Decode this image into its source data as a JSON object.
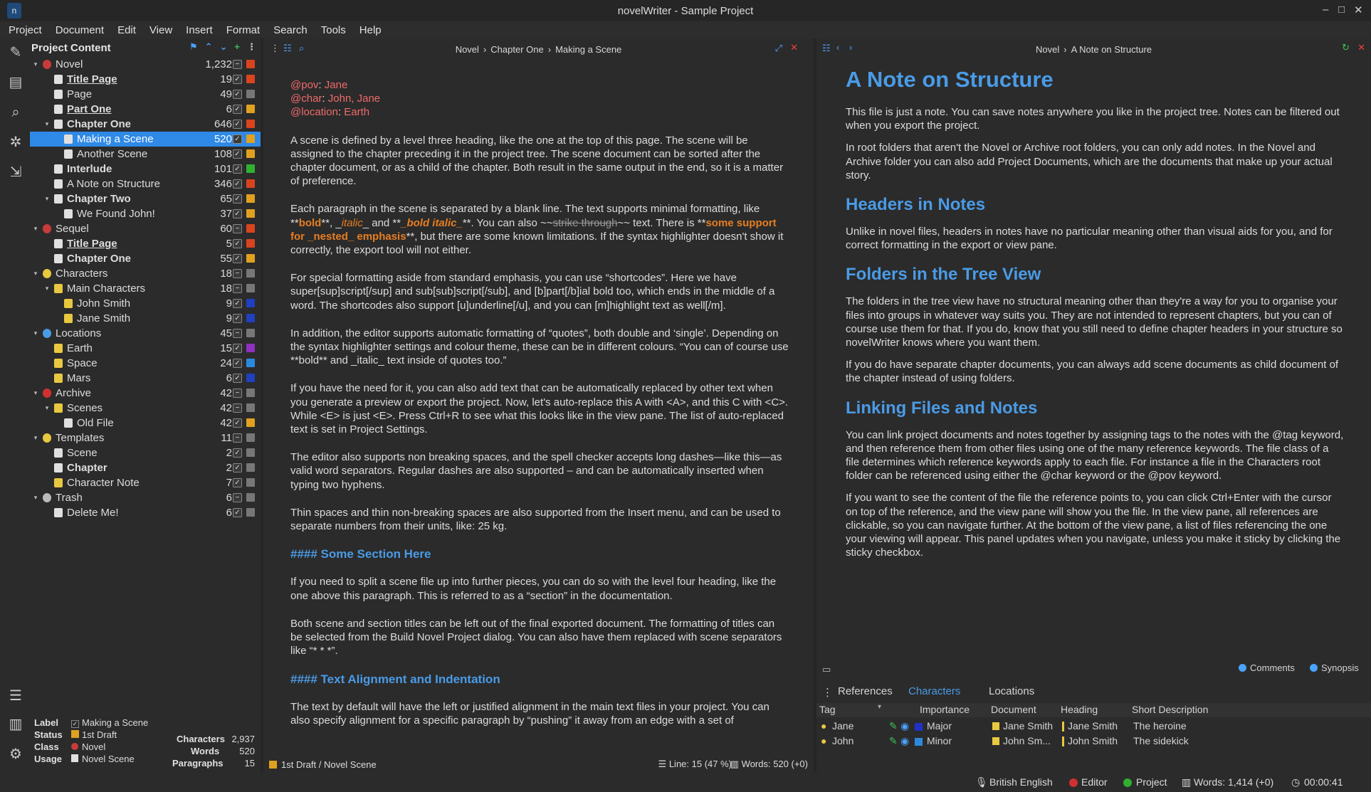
{
  "window": {
    "title": "novelWriter - Sample Project",
    "icon": "app-icon"
  },
  "menu": [
    "Project",
    "Document",
    "Edit",
    "View",
    "Insert",
    "Format",
    "Search",
    "Tools",
    "Help"
  ],
  "sidebar_icons": [
    "edit-icon",
    "book-icon",
    "search-icon",
    "plugin-icon",
    "export-icon",
    "outline-icon",
    "stats-icon",
    "settings-icon"
  ],
  "tree": {
    "title": "Project Content",
    "rows": [
      {
        "label": "Novel",
        "count": "1,232",
        "level": 0,
        "arrow": "▾",
        "icon": "#c83b3b",
        "chk": "−",
        "color": "#d9441f",
        "bold": false,
        "ul": false
      },
      {
        "label": "Title Page",
        "count": "19",
        "level": 1,
        "arrow": "",
        "icon": "#e0e0e0",
        "chk": "✓",
        "color": "#d9441f",
        "bold": true,
        "ul": true
      },
      {
        "label": "Page",
        "count": "49",
        "level": 1,
        "arrow": "",
        "icon": "#e0e0e0",
        "chk": "✓",
        "color": "#777777",
        "bold": false,
        "ul": false
      },
      {
        "label": "Part One",
        "count": "6",
        "level": 1,
        "arrow": "",
        "icon": "#e0e0e0",
        "chk": "✓",
        "color": "#e0a020",
        "bold": true,
        "ul": true
      },
      {
        "label": "Chapter One",
        "count": "646",
        "level": 1,
        "arrow": "▾",
        "icon": "#e0e0e0",
        "chk": "✓",
        "color": "#d9441f",
        "bold": true,
        "ul": false
      },
      {
        "label": "Making a Scene",
        "count": "520",
        "level": 2,
        "arrow": "",
        "icon": "#e0e0e0",
        "chk": "✓",
        "color": "#e0a020",
        "bold": false,
        "ul": false,
        "sel": true
      },
      {
        "label": "Another Scene",
        "count": "108",
        "level": 2,
        "arrow": "",
        "icon": "#e0e0e0",
        "chk": "✓",
        "color": "#e0a020",
        "bold": false,
        "ul": false
      },
      {
        "label": "Interlude",
        "count": "101",
        "level": 1,
        "arrow": "",
        "icon": "#e0e0e0",
        "chk": "✓",
        "color": "#30b030",
        "bold": true,
        "ul": false
      },
      {
        "label": "A Note on Structure",
        "count": "346",
        "level": 1,
        "arrow": "",
        "icon": "#e0e0e0",
        "chk": "✓",
        "color": "#d9441f",
        "bold": false,
        "ul": false
      },
      {
        "label": "Chapter Two",
        "count": "65",
        "level": 1,
        "arrow": "▾",
        "icon": "#e0e0e0",
        "chk": "✓",
        "color": "#e0a020",
        "bold": true,
        "ul": false
      },
      {
        "label": "We Found John!",
        "count": "37",
        "level": 2,
        "arrow": "",
        "icon": "#e0e0e0",
        "chk": "✓",
        "color": "#e0a020",
        "bold": false,
        "ul": false
      },
      {
        "label": "Sequel",
        "count": "60",
        "level": 0,
        "arrow": "▾",
        "icon": "#c83b3b",
        "chk": "−",
        "color": "#d9441f",
        "bold": false,
        "ul": false
      },
      {
        "label": "Title Page",
        "count": "5",
        "level": 1,
        "arrow": "",
        "icon": "#e0e0e0",
        "chk": "✓",
        "color": "#d9441f",
        "bold": true,
        "ul": true
      },
      {
        "label": "Chapter One",
        "count": "55",
        "level": 1,
        "arrow": "",
        "icon": "#e0e0e0",
        "chk": "✓",
        "color": "#e0a020",
        "bold": true,
        "ul": false
      },
      {
        "label": "Characters",
        "count": "18",
        "level": 0,
        "arrow": "▾",
        "icon": "#e8c840",
        "chk": "−",
        "color": "#777777",
        "bold": false,
        "ul": false
      },
      {
        "label": "Main Characters",
        "count": "18",
        "level": 1,
        "arrow": "▾",
        "icon": "#e8c840",
        "chk": "−",
        "color": "#777777",
        "bold": false,
        "ul": false
      },
      {
        "label": "John Smith",
        "count": "9",
        "level": 2,
        "arrow": "",
        "icon": "#e8c840",
        "chk": "✓",
        "color": "#2040c0",
        "bold": false,
        "ul": false
      },
      {
        "label": "Jane Smith",
        "count": "9",
        "level": 2,
        "arrow": "",
        "icon": "#e8c840",
        "chk": "✓",
        "color": "#2040c0",
        "bold": false,
        "ul": false
      },
      {
        "label": "Locations",
        "count": "45",
        "level": 0,
        "arrow": "▾",
        "icon": "#4a9be6",
        "chk": "−",
        "color": "#777777",
        "bold": false,
        "ul": false
      },
      {
        "label": "Earth",
        "count": "15",
        "level": 1,
        "arrow": "",
        "icon": "#e8c840",
        "chk": "✓",
        "color": "#9030c0",
        "bold": false,
        "ul": false
      },
      {
        "label": "Space",
        "count": "24",
        "level": 1,
        "arrow": "",
        "icon": "#e8c840",
        "chk": "✓",
        "color": "#2a8ae0",
        "bold": false,
        "ul": false
      },
      {
        "label": "Mars",
        "count": "6",
        "level": 1,
        "arrow": "",
        "icon": "#e8c840",
        "chk": "✓",
        "color": "#2040c0",
        "bold": false,
        "ul": false
      },
      {
        "label": "Archive",
        "count": "42",
        "level": 0,
        "arrow": "▾",
        "icon": "#d03030",
        "chk": "−",
        "color": "#777777",
        "bold": false,
        "ul": false
      },
      {
        "label": "Scenes",
        "count": "42",
        "level": 1,
        "arrow": "▾",
        "icon": "#e8c840",
        "chk": "−",
        "color": "#777777",
        "bold": false,
        "ul": false
      },
      {
        "label": "Old File",
        "count": "42",
        "level": 2,
        "arrow": "",
        "icon": "#e0e0e0",
        "chk": "✓",
        "color": "#e0a020",
        "bold": false,
        "ul": false
      },
      {
        "label": "Templates",
        "count": "11",
        "level": 0,
        "arrow": "▾",
        "icon": "#e8c840",
        "chk": "−",
        "color": "#777777",
        "bold": false,
        "ul": false
      },
      {
        "label": "Scene",
        "count": "2",
        "level": 1,
        "arrow": "",
        "icon": "#e0e0e0",
        "chk": "✓",
        "color": "#777777",
        "bold": false,
        "ul": false
      },
      {
        "label": "Chapter",
        "count": "2",
        "level": 1,
        "arrow": "",
        "icon": "#e0e0e0",
        "chk": "✓",
        "color": "#777777",
        "bold": true,
        "ul": false
      },
      {
        "label": "Character Note",
        "count": "7",
        "level": 1,
        "arrow": "",
        "icon": "#e8c840",
        "chk": "✓",
        "color": "#777777",
        "bold": false,
        "ul": false
      },
      {
        "label": "Trash",
        "count": "6",
        "level": 0,
        "arrow": "▾",
        "icon": "#bbbbbb",
        "chk": "−",
        "color": "#777777",
        "bold": false,
        "ul": false
      },
      {
        "label": "Delete Me!",
        "count": "6",
        "level": 1,
        "arrow": "",
        "icon": "#e0e0e0",
        "chk": "✓",
        "color": "#777777",
        "bold": false,
        "ul": false
      }
    ]
  },
  "details": {
    "label_key": "Label",
    "label_val": "Making a Scene",
    "status_key": "Status",
    "status_val": "1st Draft",
    "class_key": "Class",
    "class_val": "Novel",
    "usage_key": "Usage",
    "usage_val": "Novel Scene",
    "chars_key": "Characters",
    "chars_val": "2,937",
    "words_key": "Words",
    "words_val": "520",
    "paras_key": "Paragraphs",
    "paras_val": "15"
  },
  "editor": {
    "crumb": [
      "Novel",
      "Chapter One",
      "Making a Scene"
    ],
    "meta": [
      {
        "k": "@pov",
        "v": "Jane"
      },
      {
        "k": "@char",
        "v": "John, Jane"
      },
      {
        "k": "@location",
        "v": "Earth"
      }
    ],
    "p1": "A scene is defined by a level three heading, like the one at the top of this page. The scene will be assigned to the chapter preceding it in the project tree. The scene document can be sorted after the chapter document, or as a child of the chapter. Both result in the same output in the end, so it is a matter of preference.",
    "p2a": "Each paragraph in the scene is separated by a blank line. The text supports minimal formatting, like **",
    "p2b": "bold",
    "p2c": "**, _",
    "p2d": "italic",
    "p2e": "_ and **",
    "p2f": "_bold italic_",
    "p2g": "**. You can also ~~",
    "p2h": "strike through",
    "p2i": "~~ text. There is **",
    "p2j": "some support for _nested_ emphasis",
    "p2k": "**, but there are some known limitations. If the syntax highlighter doesn't show it correctly, the export tool will not either.",
    "p3": "For special formatting aside from standard emphasis, you can use “shortcodes”. Here we have super[sup]script[/sup] and sub[sub]script[/sub], and [b]part[/b]ial bold too, which ends in the middle of a word. The shortcodes also support [u]underline[/u], and you can [m]highlight text as well[/m].",
    "p4": "In addition, the editor supports automatic formatting of “quotes”, both double and ‘single’. Depending on the syntax highlighter settings and colour theme, these can be in different colours. “You can of course use **bold** and _italic_ text inside of quotes too.”",
    "p5": "If you have the need for it, you can also add text that can be automatically replaced by other text when you generate a preview or export the project. Now, let's auto-replace this A with <A>, and this C with <C>. While <E> is just <E>. Press Ctrl+R to see what this looks like in the view pane. The list of auto-replaced text is set in Project Settings.",
    "p6": "The editor also supports non breaking spaces, and the spell checker accepts long dashes—like this—as valid word separators. Regular dashes are also supported – and can be automatically inserted when typing two hyphens.",
    "p7": "Thin spaces and thin non-breaking spaces are also supported from the Insert menu, and can be used to separate numbers from their units, like: 25 kg.",
    "h4a": "#### Some Section Here",
    "p8": "If you need to split a scene file up into further pieces, you can do so with the level four heading, like the one above this paragraph. This is referred to as a “section” in the documentation.",
    "p9": "Both scene and section titles can be left out of the final exported document. The formatting of titles can be selected from the Build Novel Project dialog. You can also have them replaced with scene separators like “* * *”.",
    "h4b": "#### Text Alignment and Indentation",
    "p10": "The text by default will have the left or justified alignment in the main text files in your project. You can also specify alignment for a specific paragraph by “pushing” it away from an edge with a set of",
    "foot_status": "1st Draft / Novel Scene",
    "foot_line": "Line: 15 (47 %)",
    "foot_words": "Words: 520 (+0)"
  },
  "viewer": {
    "crumb": [
      "Novel",
      "A Note on Structure"
    ],
    "h1": "A Note on Structure",
    "p1": "This file is just a note. You can save notes anywhere you like in the project tree. Notes can be filtered out when you export the project.",
    "p2": "In root folders that aren't the Novel or Archive root folders, you can only add notes. In the Novel and Archive folder you can also add Project Documents, which are the documents that make up your actual story.",
    "h2a": "Headers in Notes",
    "p3": "Unlike in novel files, headers in notes have no particular meaning other than visual aids for you, and for correct formatting in the export or view pane.",
    "h2b": "Folders in the Tree View",
    "p4": "The folders in the tree view have no structural meaning other than they're a way for you to organise your files into groups in whatever way suits you. They are not intended to represent chapters, but you can of course use them for that. If you do, know that you still need to define chapter headers in your structure so novelWriter knows where you want them.",
    "p5": "If you do have separate chapter documents, you can always add scene documents as child document of the chapter instead of using folders.",
    "h2c": "Linking Files and Notes",
    "p6": "You can link project documents and notes together by assigning tags to the notes with the @tag keyword, and then reference them from other files using one of the many reference keywords. The file class of a file determines which reference keywords apply to each file. For instance a file in the Characters root folder can be referenced using either the @char keyword or the @pov keyword.",
    "p7": "If you want to see the content of the file the reference points to, you can click Ctrl+Enter with the cursor on top of the reference, and the view pane will show you the file. In the view pane, all references are clickable, so you can navigate further. At the bottom of the view pane, a list of files referencing the one your viewing will appear. This panel updates when you navigate, unless you make it sticky by clicking the sticky checkbox.",
    "opt_comments": "Comments",
    "opt_synopsis": "Synopsis"
  },
  "refpanel": {
    "tabs": [
      "References",
      "Characters",
      "Locations"
    ],
    "active_tab": "Characters",
    "columns": [
      "Tag",
      "Importance",
      "Document",
      "Heading",
      "Short Description"
    ],
    "rows": [
      {
        "tag": "Jane",
        "importance": "Major",
        "imp_color": "#2030c8",
        "document": "Jane Smith",
        "heading": "Jane Smith",
        "desc": "The heroine"
      },
      {
        "tag": "John",
        "importance": "Minor",
        "imp_color": "#2a8ae0",
        "document": "John Sm...",
        "heading": "John Smith",
        "desc": "The sidekick"
      }
    ]
  },
  "status": {
    "language": "British English",
    "editor": "Editor",
    "project": "Project",
    "words": "Words: 1,414 (+0)",
    "time": "00:00:41",
    "editor_color": "#d03030",
    "project_color": "#30b030"
  },
  "colors": {
    "accent": "#4a9be6",
    "selection": "#2f89e6",
    "background": "#2b2b2b"
  }
}
